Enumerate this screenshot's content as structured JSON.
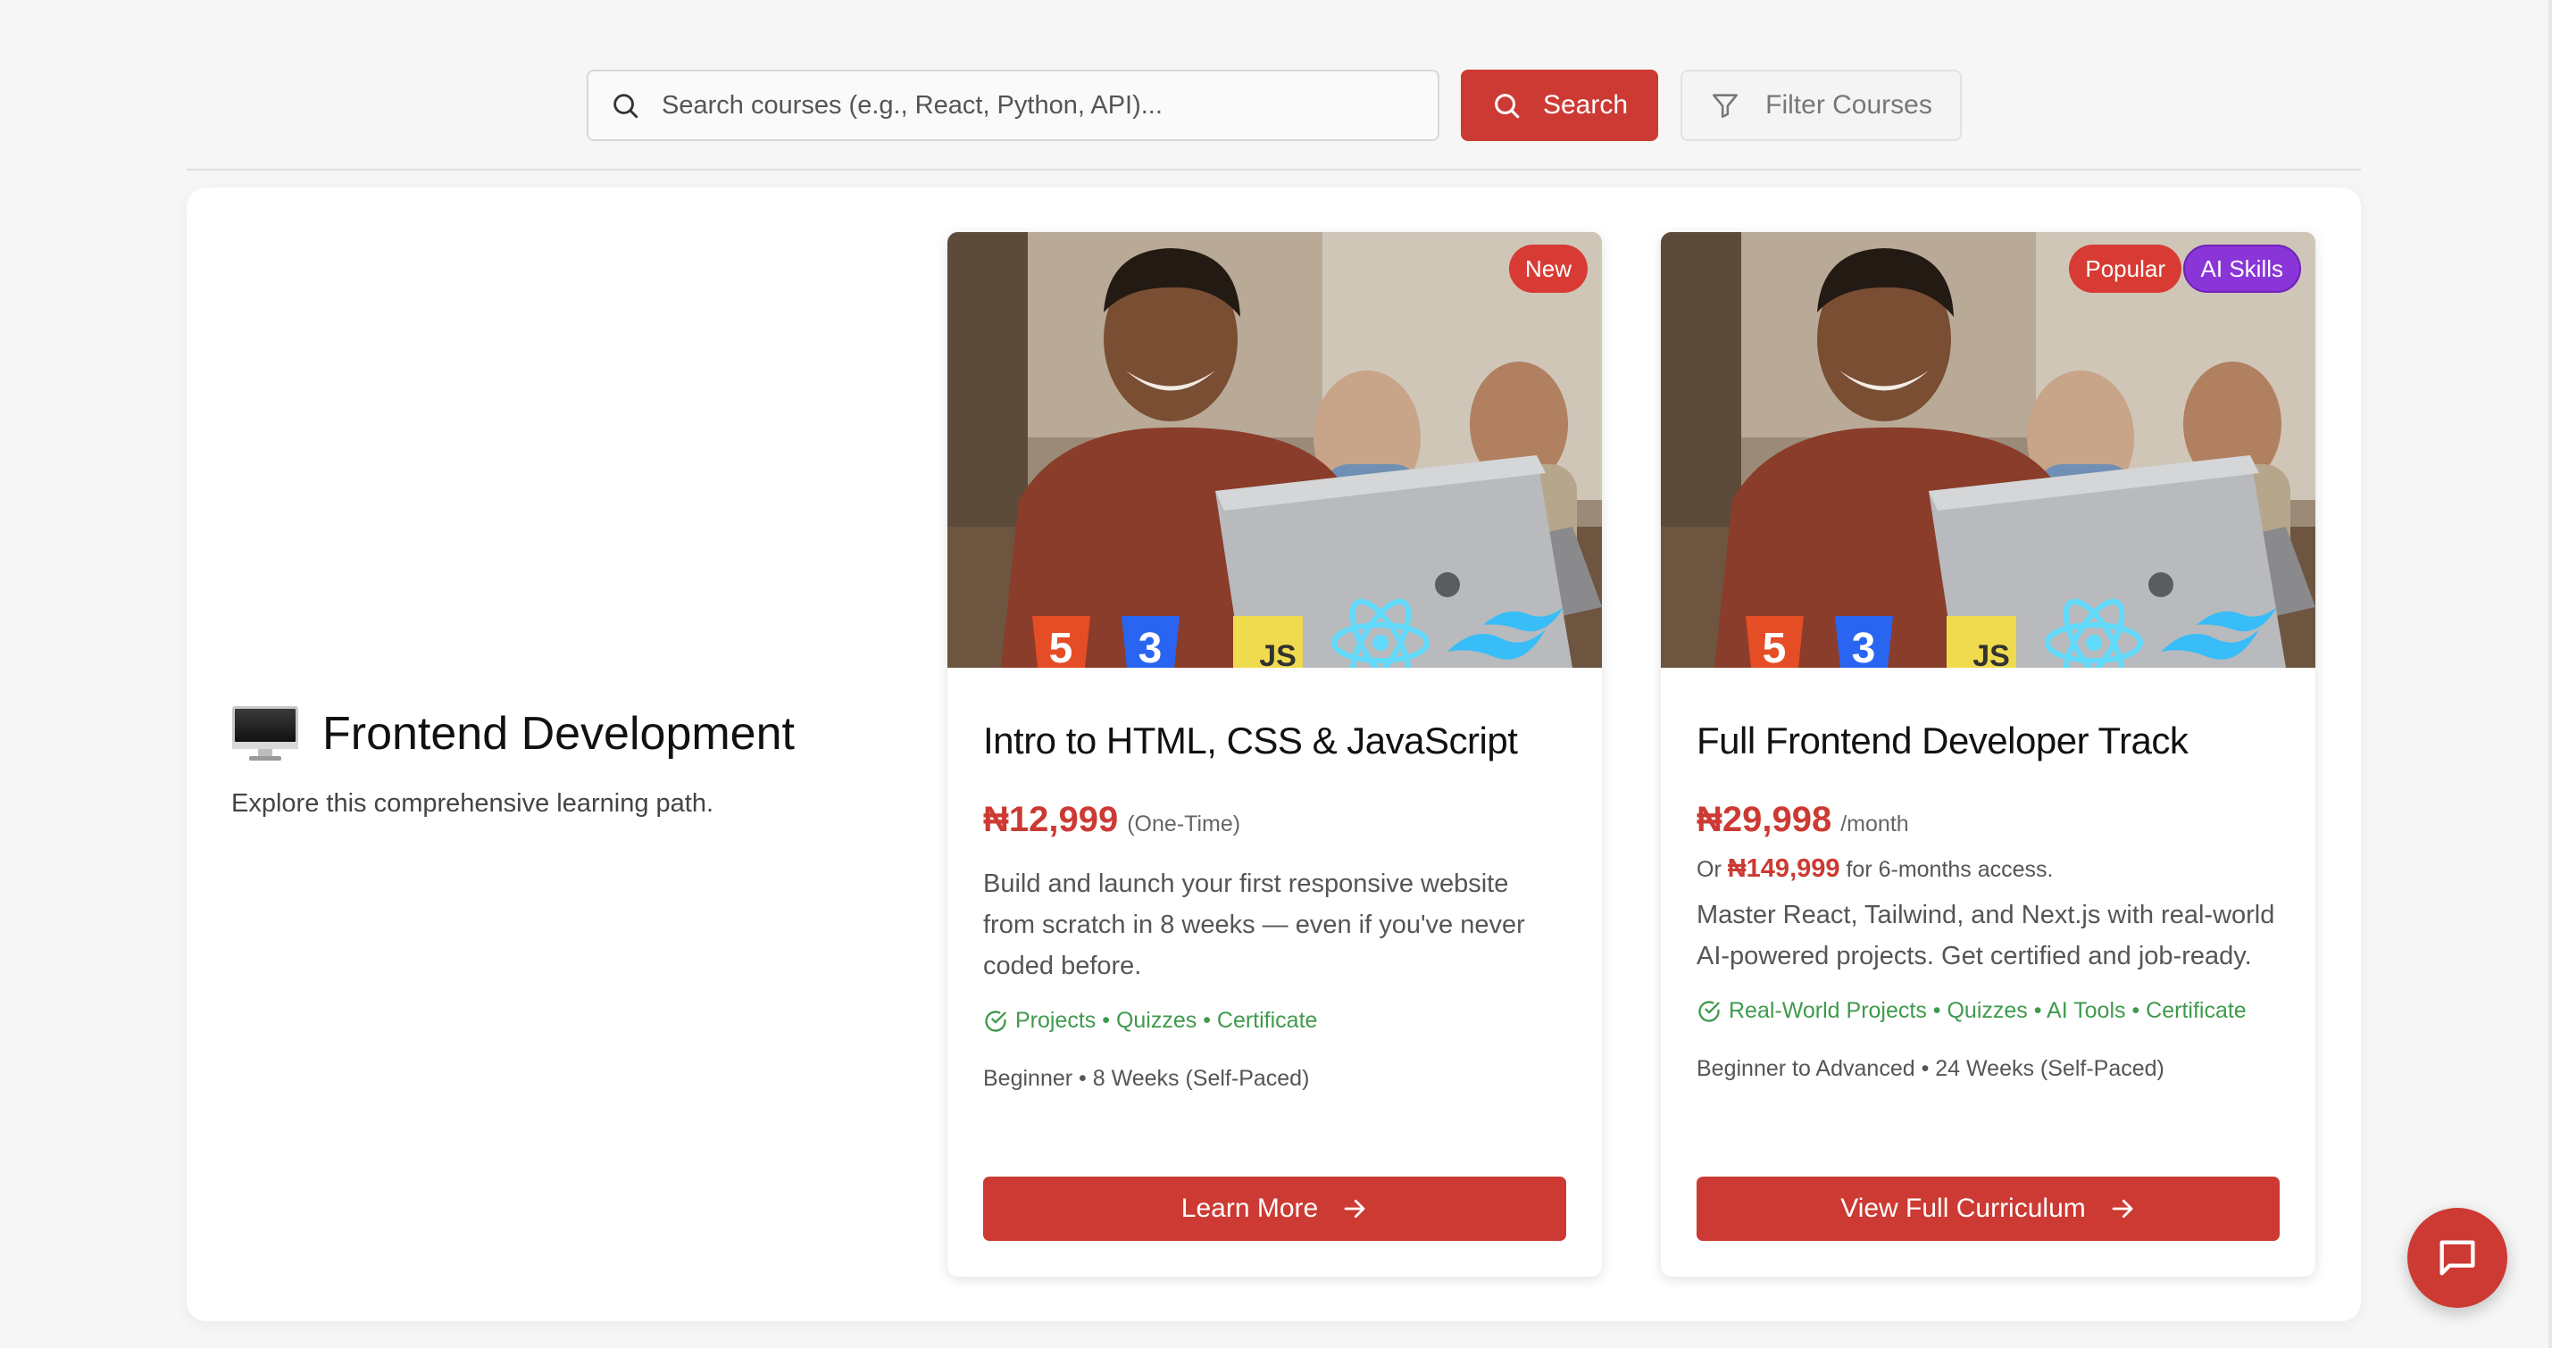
{
  "search": {
    "placeholder": "Search courses (e.g., React, Python, API)...",
    "button_label": "Search",
    "filter_label": "Filter Courses",
    "icons": {
      "search": "search-icon",
      "filter": "filter-icon"
    }
  },
  "category": {
    "icon": "monitor-icon",
    "title": "Frontend Development",
    "subtitle": "Explore this comprehensive learning path."
  },
  "courses": [
    {
      "badges": [
        {
          "label": "New",
          "color": "#d83b33"
        }
      ],
      "title": "Intro to HTML, CSS & JavaScript",
      "price": "₦12,999",
      "price_note": "(One-Time)",
      "description": "Build and launch your first responsive website from scratch in 8 weeks — even if you've never coded before.",
      "features": "Projects • Quizzes • Certificate",
      "meta": "Beginner • 8 Weeks (Self-Paced)",
      "cta": "Learn More"
    },
    {
      "badges": [
        {
          "label": "Popular",
          "color": "#d83b33"
        },
        {
          "label": "AI Skills",
          "color": "#8a35d8"
        }
      ],
      "title": "Full Frontend Developer Track",
      "price": "₦29,998",
      "price_note": "/month",
      "alt_price_prefix": "Or",
      "alt_price": "₦149,999",
      "alt_price_suffix": "for 6-months access.",
      "description": "Master React, Tailwind, and Next.js with real-world AI-powered projects. Get certified and job-ready.",
      "features": "Real-World Projects • Quizzes • AI Tools • Certificate",
      "meta": "Beginner to Advanced • 24 Weeks (Self-Paced)",
      "cta": "View Full Curriculum"
    }
  ],
  "chat": {
    "icon": "chat-bubble-icon"
  },
  "colors": {
    "accent": "#cc3a33",
    "feature_green": "#3f9a4c",
    "badge_purple": "#8a35d8"
  }
}
